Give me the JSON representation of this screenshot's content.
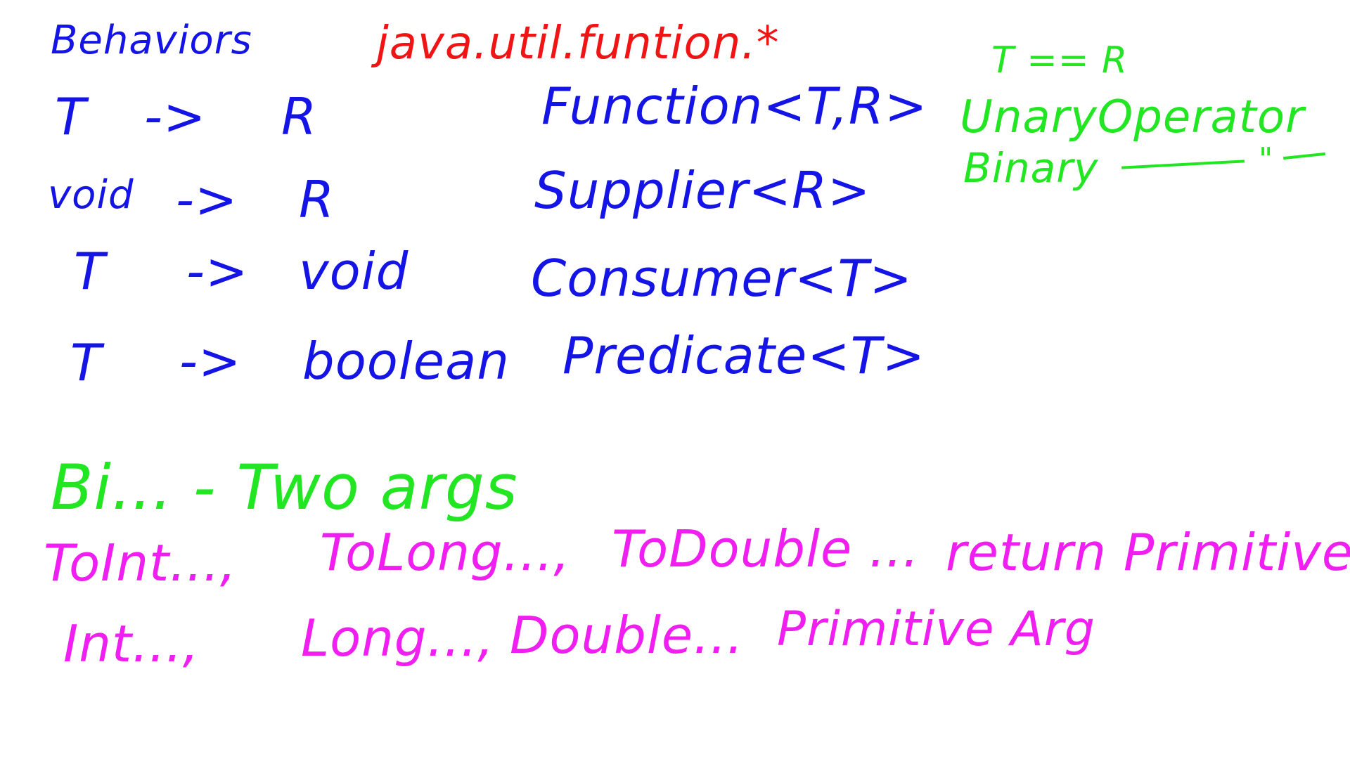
{
  "board": {
    "title": "Behaviors",
    "package": "java.util.funtion.*",
    "rows": [
      {
        "input": "T",
        "arrow": "->",
        "output": "R",
        "interface": "Function<T,R>"
      },
      {
        "input": "void",
        "arrow": "->",
        "output": "R",
        "interface": "Supplier<R>"
      },
      {
        "input": "T",
        "arrow": "->",
        "output": "void",
        "interface": "Consumer<T>"
      },
      {
        "input": "T",
        "arrow": "->",
        "output": "boolean",
        "interface": "Predicate<T>"
      }
    ],
    "notes": {
      "t_equals_r": "T == R",
      "unary": "UnaryOperator",
      "binary": "Binary",
      "ditto": "\""
    },
    "bi_note": "Bi...  - Two args",
    "primitive_lines": [
      [
        "ToInt...,",
        "ToLong...,",
        "ToDouble ...",
        "return Primitive"
      ],
      [
        "Int...,",
        "Long...,",
        "Double...",
        "Primitive Arg"
      ]
    ],
    "colors": {
      "blue": "#1414e6",
      "red": "#f01414",
      "green": "#22e622",
      "magenta": "#f01ef0"
    }
  }
}
